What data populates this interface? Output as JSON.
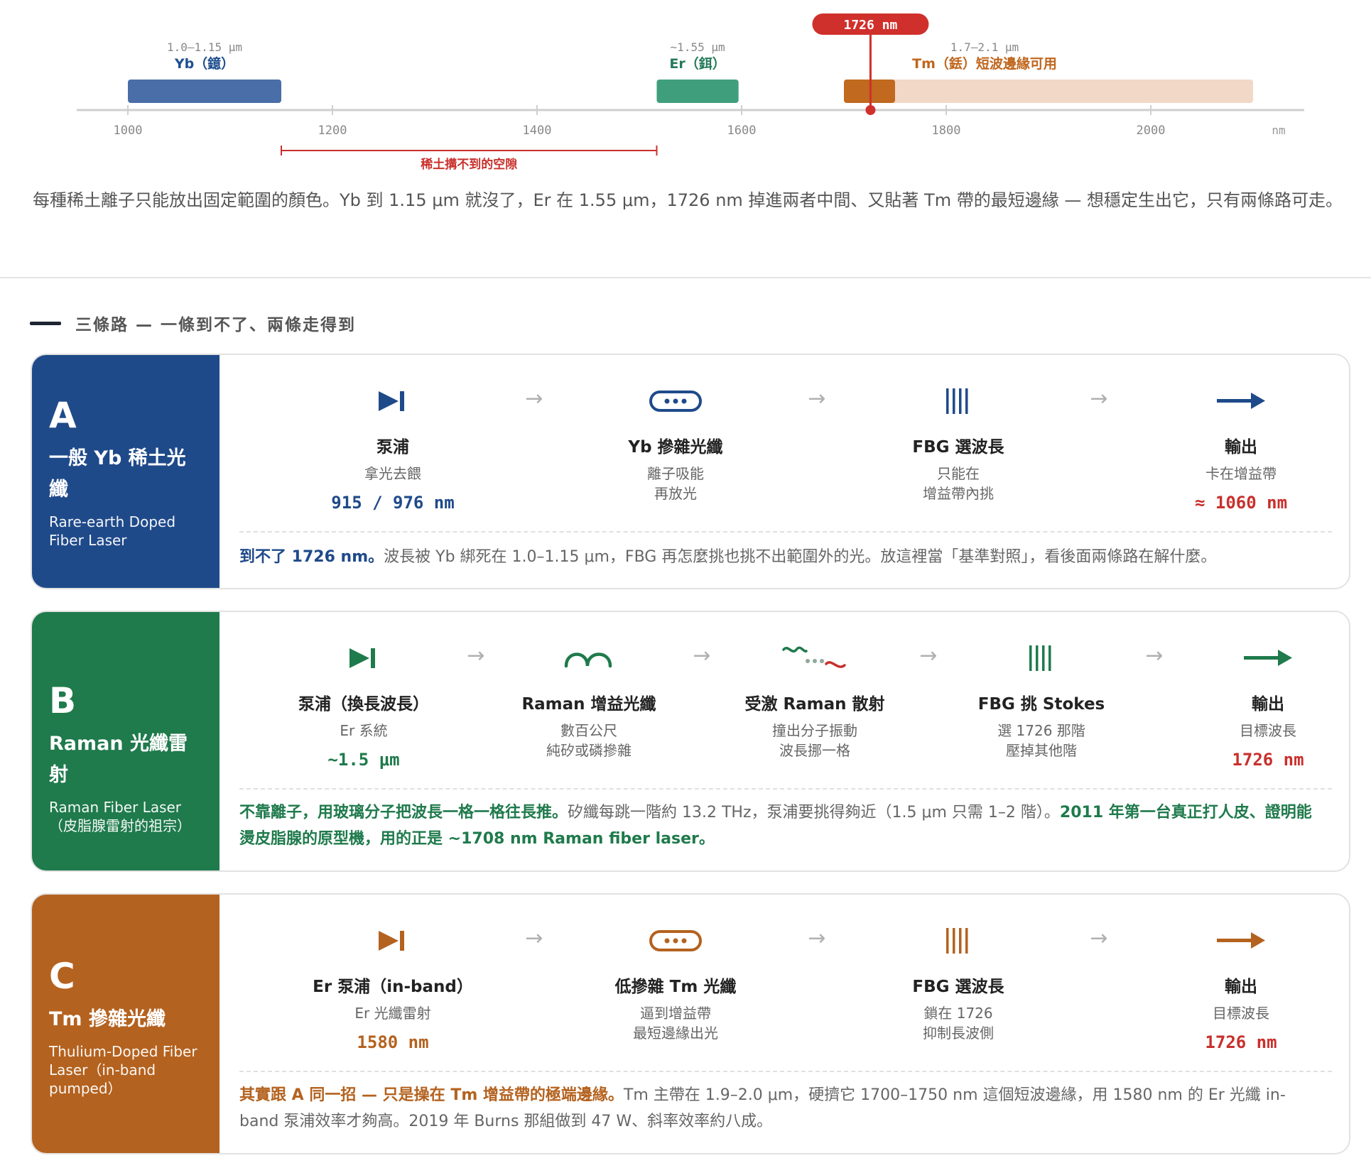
{
  "spectrum": {
    "ticks": [
      "1000",
      "1200",
      "1400",
      "1600",
      "1800",
      "2000"
    ],
    "unit": "nm",
    "range": [
      1000,
      2130
    ],
    "bands": [
      {
        "key": "yb",
        "from": 1000,
        "to": 1150,
        "range": "1.0–1.15 μm",
        "name": "Yb（鐿）",
        "color": "#4a6ea8",
        "label_color": "#1f4f8e"
      },
      {
        "key": "er",
        "from": 1517,
        "to": 1597,
        "range": "~1.55 μm",
        "name": "Er（鉺）",
        "color": "#3f9f7c",
        "label_color": "#257a5a"
      },
      {
        "key": "tm",
        "from": 1700,
        "to": 2100,
        "range": "1.7–2.1 μm",
        "name": "Tm（銩）短波邊緣可用",
        "color": "#f2d8c7",
        "label_color": "#c0661d"
      }
    ],
    "tm_edge": {
      "from": 1700,
      "to": 1750,
      "color": "#c0691f"
    },
    "marker": {
      "value": 1726,
      "label": "1726 nm",
      "color": "#d0302b"
    },
    "gap": {
      "from": 1150,
      "to": 1517,
      "label": "稀土搆不到的空隙",
      "color": "#c9302c"
    }
  },
  "intro": "每種稀土離子只能放出固定範圍的顏色。Yb 到 1.15 μm 就沒了，Er 在 1.55 μm，1726 nm 掉進兩者中間、又貼著 Tm 帶的最短邊緣 — 想穩定生出它，只有兩條路可走。",
  "section_title": "三條路 — 一條到不了、兩條走得到",
  "cards": {
    "a": {
      "color": "#1f4a8a",
      "letter": "A",
      "name": "一般 Yb 稀土光纖",
      "en": "Rare-earth Doped Fiber Laser",
      "steps": [
        {
          "icon": "pump-icon",
          "title": "泵浦",
          "sub1": "拿光去餵",
          "sub2": "",
          "value": "915 / 976 nm"
        },
        {
          "icon": "doped-fiber-icon",
          "title": "Yb 摻雜光纖",
          "sub1": "離子吸能",
          "sub2": "再放光",
          "value": ""
        },
        {
          "icon": "fbg-icon",
          "title": "FBG 選波長",
          "sub1": "只能在",
          "sub2": "增益帶內挑",
          "value": ""
        },
        {
          "icon": "output-arrow-icon",
          "title": "輸出",
          "sub1": "卡在增益帶",
          "sub2": "",
          "value": "≈ 1060 nm"
        }
      ],
      "note_bold": "到不了 1726 nm。",
      "note_rest": "波長被 Yb 綁死在 1.0–1.15 μm，FBG 再怎麼挑也挑不出範圍外的光。放這裡當「基準對照」，看後面兩條路在解什麼。"
    },
    "b": {
      "color": "#1f7a4c",
      "letter": "B",
      "name": "Raman 光纖雷射",
      "en1": "Raman Fiber Laser",
      "en2": "（皮脂腺雷射的祖宗）",
      "steps": [
        {
          "icon": "pump-icon",
          "title": "泵浦（換長波長）",
          "sub1": "Er 系統",
          "sub2": "",
          "value": "~1.5 μm"
        },
        {
          "icon": "raman-fiber-icon",
          "title": "Raman 增益光纖",
          "sub1": "數百公尺",
          "sub2": "純矽或磷摻雜",
          "value": ""
        },
        {
          "icon": "raman-scatter-icon",
          "title": "受激 Raman 散射",
          "sub1": "撞出分子振動",
          "sub2": "波長挪一格",
          "value": ""
        },
        {
          "icon": "fbg-icon",
          "title": "FBG 挑 Stokes",
          "sub1": "選 1726 那階",
          "sub2": "壓掉其他階",
          "value": ""
        },
        {
          "icon": "output-arrow-icon",
          "title": "輸出",
          "sub1": "目標波長",
          "sub2": "",
          "value": "1726 nm"
        }
      ],
      "note_bold": "不靠離子，用玻璃分子把波長一格一格往長推。",
      "note_mid": "矽纖每跳一階約 13.2 THz，泵浦要挑得夠近（1.5 μm 只需 1–2 階）。",
      "note_bold2": "2011 年第一台真正打人皮、證明能燙皮脂腺的原型機，用的正是 ~1708 nm Raman fiber laser。"
    },
    "c": {
      "color": "#b4621f",
      "letter": "C",
      "name": "Tm 摻雜光纖",
      "en": "Thulium-Doped Fiber Laser（in-band pumped）",
      "steps": [
        {
          "icon": "pump-icon",
          "title": "Er 泵浦（in-band）",
          "sub1": "Er 光纖雷射",
          "sub2": "",
          "value": "1580 nm"
        },
        {
          "icon": "doped-fiber-icon",
          "title": "低摻雜 Tm 光纖",
          "sub1": "逼到增益帶",
          "sub2": "最短邊緣出光",
          "value": ""
        },
        {
          "icon": "fbg-icon",
          "title": "FBG 選波長",
          "sub1": "鎖在 1726",
          "sub2": "抑制長波側",
          "value": ""
        },
        {
          "icon": "output-arrow-icon",
          "title": "輸出",
          "sub1": "目標波長",
          "sub2": "",
          "value": "1726 nm"
        }
      ],
      "note_bold": "其實跟 A 同一招 — 只是操在 Tm 增益帶的極端邊緣。",
      "note_rest": "Tm 主帶在 1.9–2.0 μm，硬擠它 1700–1750 nm 這個短波邊緣，用 1580 nm 的 Er 光纖 in-band 泵浦效率才夠高。2019 年 Burns 那組做到 47 W、斜率效率約八成。"
    },
    "red": "#c8302c",
    "arrow": "→"
  }
}
